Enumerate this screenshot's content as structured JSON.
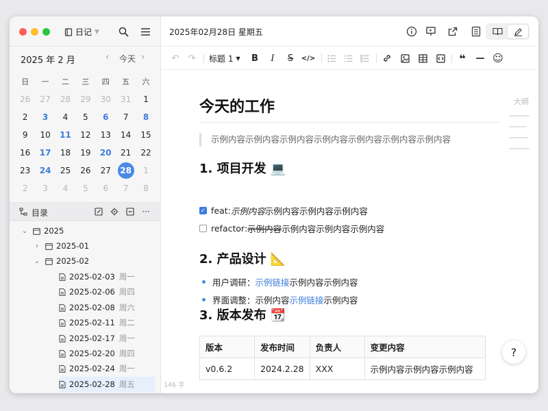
{
  "sidebar": {
    "notebook": "日记",
    "calendar": {
      "month_label": "2025 年 2 月",
      "today_label": "今天",
      "weekdays": [
        "日",
        "一",
        "二",
        "三",
        "四",
        "五",
        "六"
      ],
      "weeks": [
        [
          "26",
          "27",
          "28",
          "29",
          "30",
          "31",
          "1"
        ],
        [
          "2",
          "3",
          "4",
          "5",
          "6",
          "7",
          "8"
        ],
        [
          "9",
          "10",
          "11",
          "12",
          "13",
          "14",
          "15"
        ],
        [
          "16",
          "17",
          "18",
          "19",
          "20",
          "21",
          "22"
        ],
        [
          "23",
          "24",
          "25",
          "26",
          "27",
          "28",
          "1"
        ],
        [
          "2",
          "3",
          "4",
          "5",
          "6",
          "7",
          "8"
        ]
      ]
    },
    "toc_label": "目录",
    "tree": {
      "root": "2025",
      "folder_jan": "2025-01",
      "folder_feb": "2025-02",
      "entries": [
        {
          "date": "2025-02-03",
          "weekday": "周一"
        },
        {
          "date": "2025-02-06",
          "weekday": "周四"
        },
        {
          "date": "2025-02-08",
          "weekday": "周六"
        },
        {
          "date": "2025-02-11",
          "weekday": "周二"
        },
        {
          "date": "2025-02-17",
          "weekday": "周一"
        },
        {
          "date": "2025-02-20",
          "weekday": "周四"
        },
        {
          "date": "2025-02-24",
          "weekday": "周一"
        },
        {
          "date": "2025-02-28",
          "weekday": "周五"
        }
      ]
    }
  },
  "main": {
    "doc_date": "2025年02月28日 星期五",
    "toolbar": {
      "heading_select": "标题 1",
      "bold": "B",
      "italic": "I",
      "strike": "S",
      "code": "</>",
      "quote": "❝",
      "rule": "—",
      "emoji": "☺"
    },
    "doc": {
      "title": "今天的工作",
      "quote": "示例内容示例内容示例内容示例内容示例内容示例内容示例内容",
      "section1": {
        "title": "1. 项目开发",
        "emoji": "💻"
      },
      "task1": {
        "prefix": "feat: ",
        "italic": "示例内容",
        "rest": "示例内容示例内容示例内容"
      },
      "task2": {
        "prefix": "refactor: ",
        "strike": "示例内容",
        "rest": "示例内容示例内容示例内容"
      },
      "section2": {
        "title": "2. 产品设计",
        "emoji": "📐"
      },
      "bullet1": {
        "label": "用户调研：",
        "link": "示例链接",
        "rest": "示例内容示例内容"
      },
      "bullet2": {
        "label": "界面调整：",
        "pre": "示例内容",
        "link": "示例链接",
        "rest": "示例内容"
      },
      "section3": {
        "title": "3. 版本发布",
        "emoji": "📆"
      },
      "table": {
        "headers": [
          "版本",
          "发布时间",
          "负责人",
          "变更内容"
        ],
        "row": [
          "v0.6.2",
          "2024.2.28",
          "XXX",
          "示例内容示例内容示例内容"
        ]
      }
    },
    "outline_label": "大纲",
    "help_label": "?",
    "word_count": "146 字"
  },
  "colors": {
    "accent": "#4a8ae6",
    "link": "#3b7ddd",
    "traffic_red": "#ff5f57",
    "traffic_yellow": "#febc2e",
    "traffic_green": "#28c840"
  }
}
